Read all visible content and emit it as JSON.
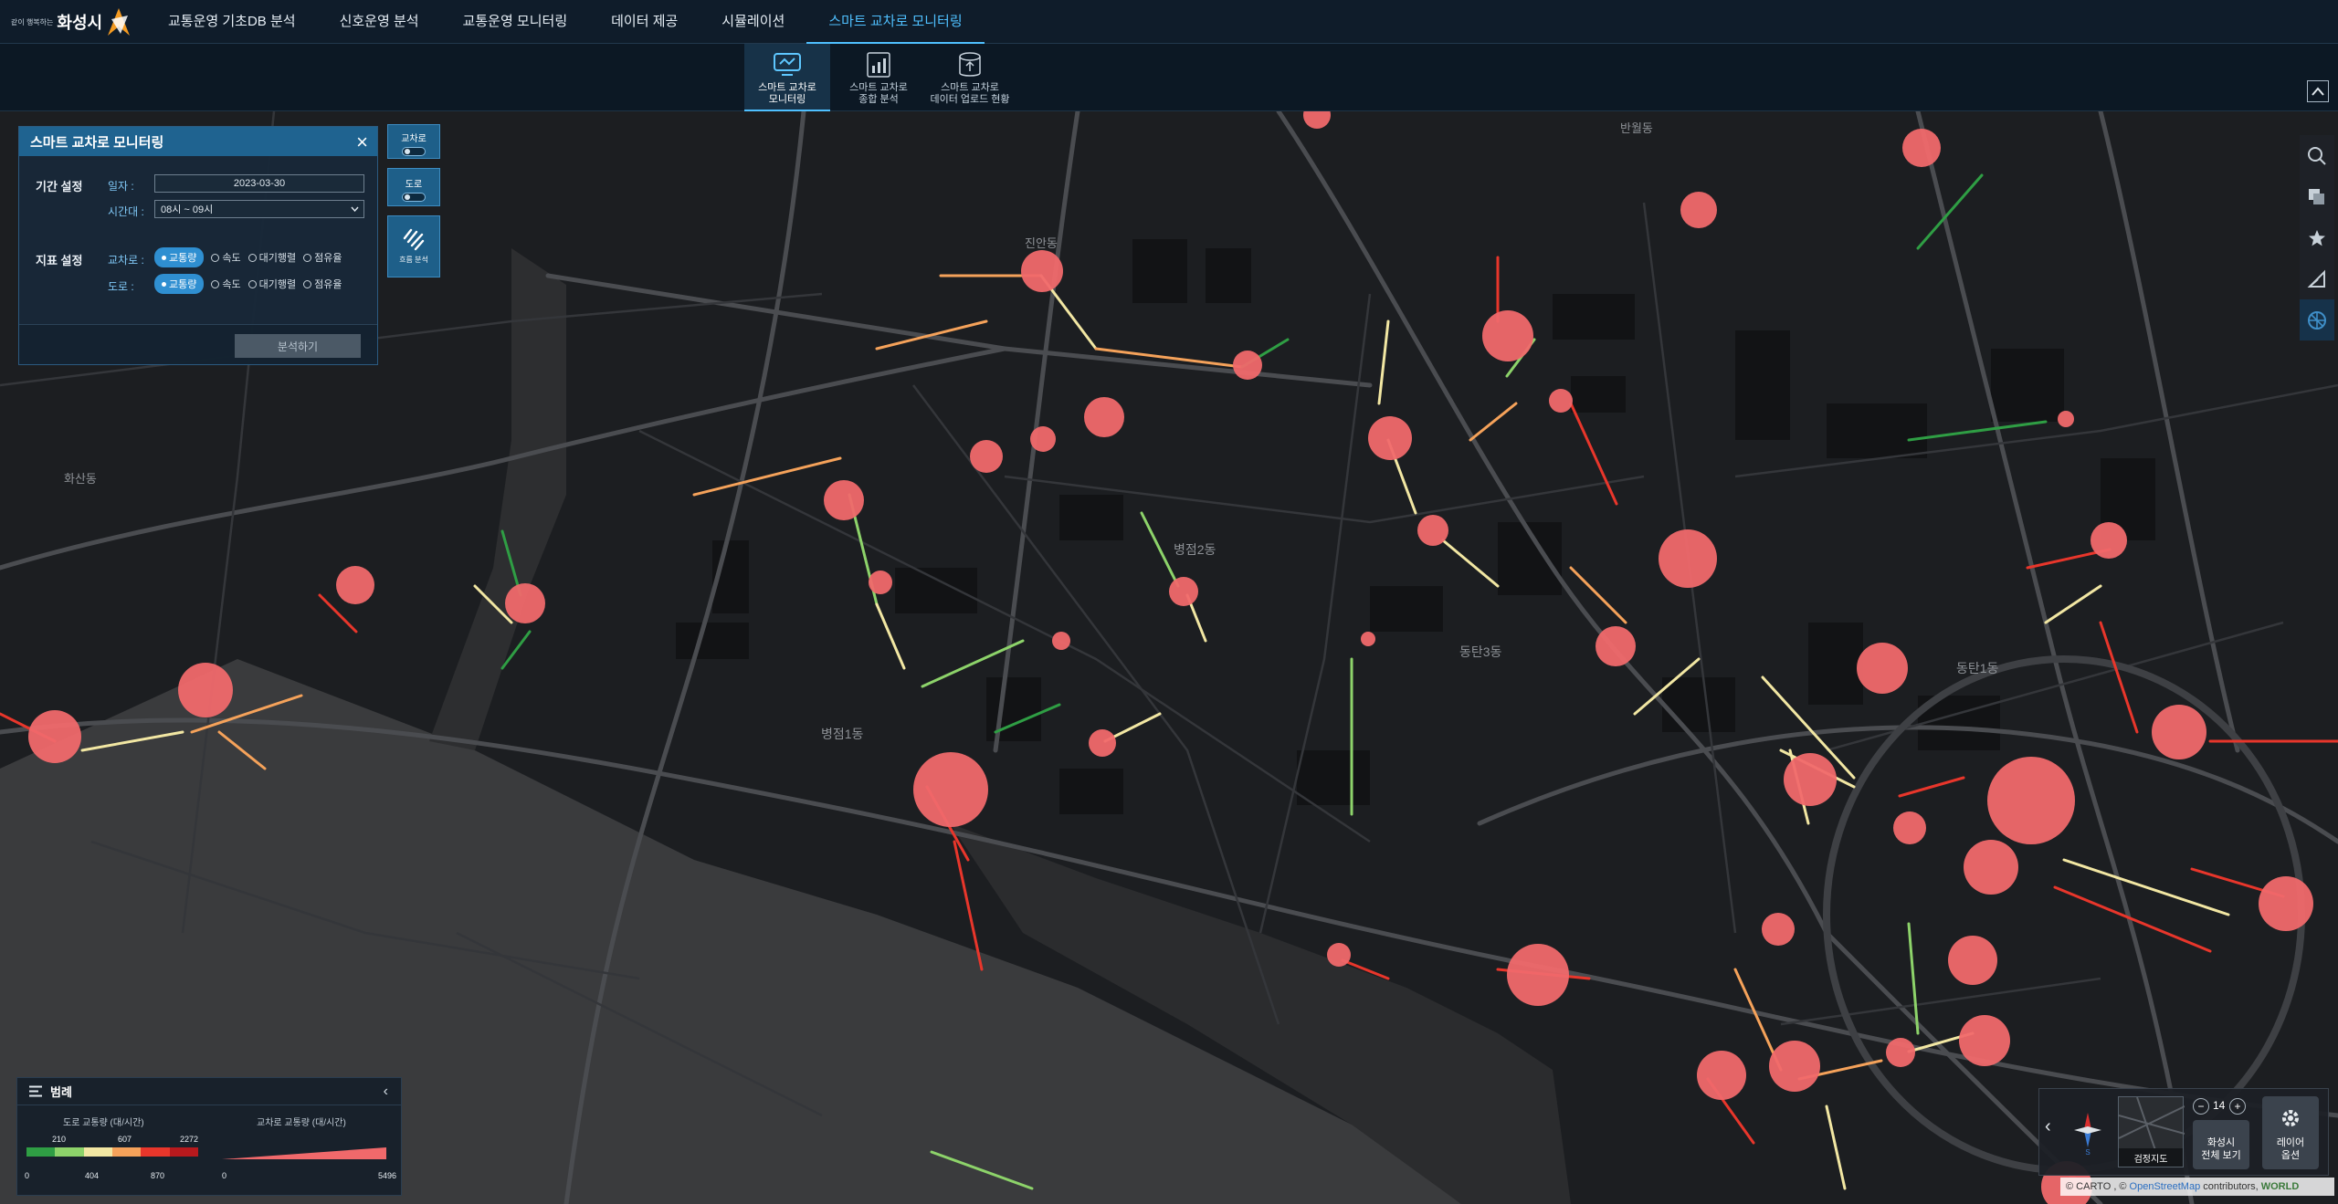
{
  "header": {
    "slogan": "같이 행복하는",
    "city": "화성시",
    "menu": [
      {
        "label": "교통운영 기초DB 분석"
      },
      {
        "label": "신호운영 분석"
      },
      {
        "label": "교통운영 모니터링"
      },
      {
        "label": "데이터 제공"
      },
      {
        "label": "시뮬레이션"
      },
      {
        "label": "스마트 교차로 모니터링",
        "active": true
      }
    ]
  },
  "submenu": [
    {
      "line1": "스마트 교차로",
      "line2": "모니터링",
      "icon": "monitor-icon",
      "active": true
    },
    {
      "line1": "스마트 교차로",
      "line2": "종합 분석",
      "icon": "analysis-chart-icon"
    },
    {
      "line1": "스마트 교차로",
      "line2": "데이터 업로드 현황",
      "icon": "database-upload-icon"
    }
  ],
  "panel": {
    "title": "스마트 교차로 모니터링",
    "period_title": "기간 설정",
    "date_label": "일자 :",
    "date_value": "2023-03-30",
    "time_label": "시간대 :",
    "time_value": "08시 ~ 09시",
    "indicator_title": "지표 설정",
    "intersection_label": "교차로 :",
    "road_label": "도로 :",
    "options": [
      "교통량",
      "속도",
      "대기행렬",
      "점유율"
    ],
    "selected_option": "교통량",
    "analyze_label": "분석하기"
  },
  "layer_toggles": {
    "intersection": "교차로",
    "road": "도로",
    "flow": "흐름 분석"
  },
  "legend": {
    "title": "범례",
    "road_title": "도로 교통량 (대/시간)",
    "road_top_ticks": [
      "210",
      "607",
      "2272"
    ],
    "road_bottom_ticks": [
      "0",
      "404",
      "870"
    ],
    "road_colors": [
      "#2f9e44",
      "#8dd36a",
      "#f2e7a3",
      "#f5a25a",
      "#e8362b",
      "#b7191d"
    ],
    "intersection_title": "교차로 교통량 (대/시간)",
    "intersection_min": "0",
    "intersection_max": "5496",
    "bubble_color": "#f0696b"
  },
  "map_labels": [
    {
      "text": "반월동"
    },
    {
      "text": "진안동"
    },
    {
      "text": "화산동"
    },
    {
      "text": "병점2동"
    },
    {
      "text": "병점1동"
    },
    {
      "text": "동탄3동"
    },
    {
      "text": "동탄1동"
    }
  ],
  "map_control": {
    "basemap_label": "검정지도",
    "zoom": "14",
    "zoom_out": "−",
    "zoom_in": "+",
    "view_all_line1": "화성시",
    "view_all_line2": "전체 보기",
    "layer_line1": "레이어",
    "layer_line2": "옵션",
    "collapse": "‹"
  },
  "attribution": {
    "copy": "© CARTO , ©",
    "osm": "OpenStreetMap",
    "contrib": "contributors,",
    "world": "WORLD"
  }
}
